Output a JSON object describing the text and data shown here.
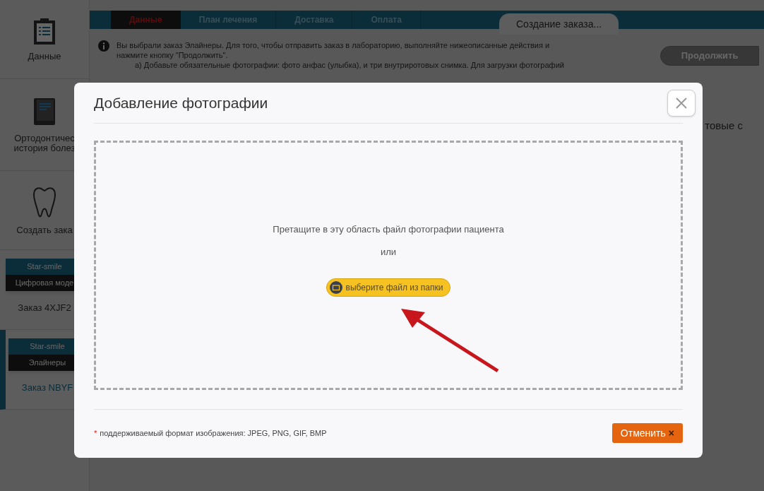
{
  "sidebar": {
    "items": [
      {
        "kind": "nav",
        "label": "Данные"
      },
      {
        "kind": "nav",
        "label": "Ортодонтичес\nистория болез"
      },
      {
        "kind": "nav",
        "label": "Создать зака"
      },
      {
        "kind": "order",
        "brand": "Star-smile",
        "product": "Цифровая моде",
        "label": "Заказ 4XJF2",
        "selected": false
      },
      {
        "kind": "order",
        "brand": "Star-smile",
        "product": "Элайнеры",
        "label": "Заказ NBYF",
        "selected": true
      }
    ]
  },
  "tabs": [
    {
      "label": "Данные",
      "selected": true
    },
    {
      "label": "План лечения",
      "selected": false
    },
    {
      "label": "Доставка",
      "selected": false
    },
    {
      "label": "Оплата",
      "selected": false
    }
  ],
  "page_title_tab": "Создание заказа...",
  "info": {
    "lines": [
      "Вы выбрали заказ Элайнеры. Для того, чтобы отправить заказ в лабораторию, выполняйте нижеописанные действия и",
      "нажмите кнопку \"Продолжить\".",
      "а) Добавьте обязательные фотографии: фото анфас (улыбка), и три внутриротовых снимка. Для загрузки фотографий"
    ]
  },
  "continue_button": "Продолжить",
  "background_fragment": "товые с",
  "dialog": {
    "title": "Добавление фотографии",
    "drop_text": "Претащите в эту область файл фотографии пациента",
    "or_text": "или",
    "choose_button": "выберите файл из папки",
    "footnote_mark": "*",
    "footnote": "поддерживаемый формат изображения: JPEG, PNG, GIF, BMP",
    "cancel_button": "Отменить",
    "cancel_icon": "×"
  }
}
